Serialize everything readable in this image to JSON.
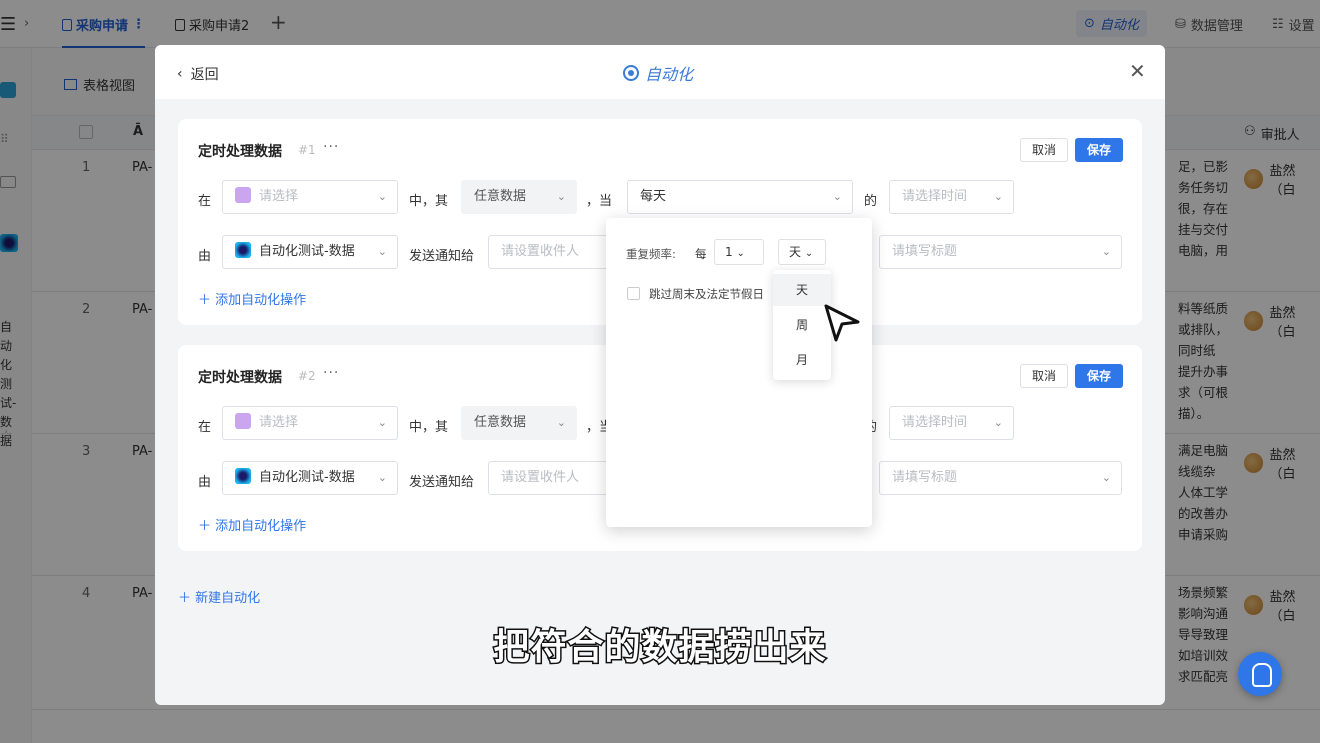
{
  "app": {
    "tabs": [
      {
        "label": "采购申请",
        "more": "⋮"
      },
      {
        "label": "采购申请2"
      }
    ],
    "top_right": {
      "automation": "自动化",
      "data_mgmt": "数据管理",
      "settings": "设置"
    },
    "view_label": "表格视图",
    "sidebar_vertical_text": "自动化测试-数据",
    "table": {
      "approver_header": "审批人",
      "rows": [
        {
          "num": "1",
          "code": "PA-",
          "approver": "盐然（白",
          "text": [
            "足，已影",
            "务任务切",
            "很，存在",
            "挂与交付",
            "电脑，用"
          ]
        },
        {
          "num": "2",
          "code": "PA-",
          "approver": "盐然（白",
          "text": [
            "料等纸质",
            "或排队，",
            "同时纸",
            "提升办事",
            "求（可根",
            "描）。"
          ]
        },
        {
          "num": "3",
          "code": "PA-",
          "approver": "盐然（白",
          "text": [
            "满足电脑",
            "线缆杂",
            "人体工学",
            "的改善办",
            "申请采购"
          ]
        },
        {
          "num": "4",
          "code": "PA-",
          "approver": "盐然（白",
          "text": [
            "场景频繁",
            "影响沟通",
            "导导致理",
            "如培训效",
            "求匹配亮"
          ]
        }
      ]
    }
  },
  "modal": {
    "back_label": "返回",
    "title": "自动化",
    "close_icon": "close-icon",
    "cards": [
      {
        "title": "定时处理数据",
        "id": "#1",
        "more": "···",
        "cancel": "取消",
        "save": "保存",
        "row1": {
          "in": "在",
          "table_placeholder": "请选择",
          "mid": "中，其",
          "data_sel": "任意数据",
          "when": "，当",
          "freq": "每天",
          "of": "的",
          "time_placeholder": "请选择时间"
        },
        "row2": {
          "by": "由",
          "source": "自动化测试-数据",
          "send": "发送通知给",
          "recipient_placeholder": "请设置收件人",
          "title_placeholder": "请填写标题"
        },
        "add_op": "添加自动化操作"
      },
      {
        "title": "定时处理数据",
        "id": "#2",
        "more": "···",
        "cancel": "取消",
        "save": "保存",
        "row1": {
          "in": "在",
          "table_placeholder": "请选择",
          "mid": "中，其",
          "data_sel": "任意数据",
          "when": "，当",
          "freq": "",
          "of": "的",
          "time_placeholder": "请选择时间"
        },
        "row2": {
          "by": "由",
          "source": "自动化测试-数据",
          "send": "发送通知给",
          "recipient_placeholder": "请设置收件人",
          "title_placeholder": "请填写标题"
        },
        "add_op": "添加自动化操作"
      }
    ],
    "new_automation": "新建自动化"
  },
  "popup": {
    "repeat_label": "重复频率:",
    "every": "每",
    "num_value": "1",
    "unit_value": "天",
    "skip_label": "跳过周末及法定节假日",
    "unit_options": [
      "天",
      "周",
      "月"
    ]
  },
  "subtitle": "把符合的数据捞出来",
  "colors": {
    "accent": "#2f76e8",
    "title_blue": "#3a7bd5"
  }
}
